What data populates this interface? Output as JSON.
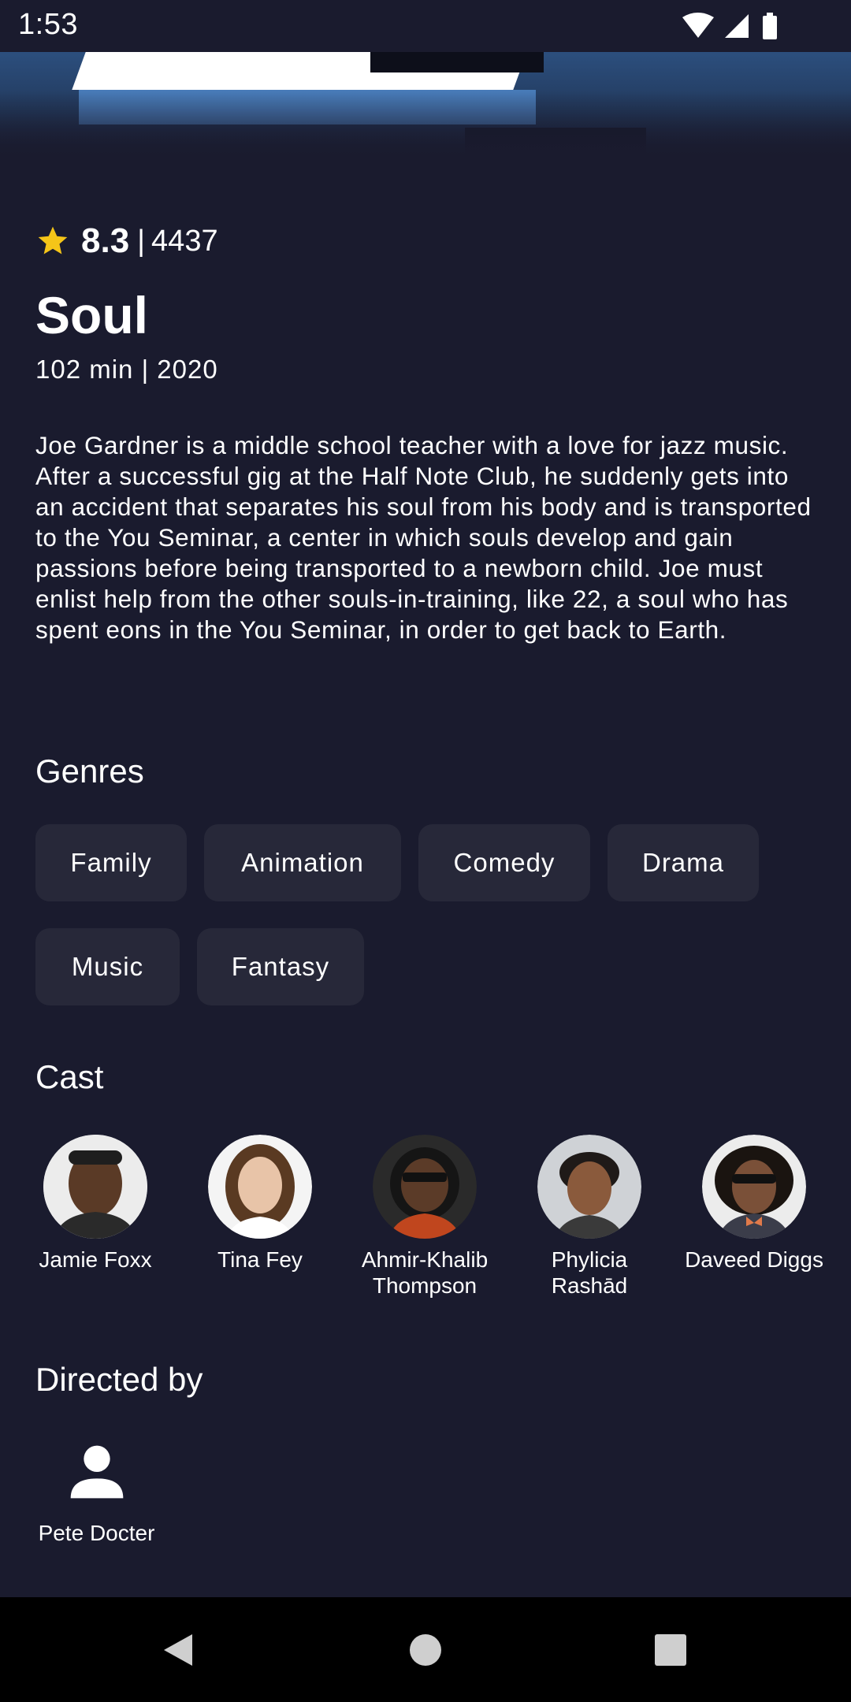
{
  "status_bar": {
    "time": "1:53"
  },
  "movie": {
    "rating": "8.3",
    "separator": "|",
    "vote_count": "4437",
    "title": "Soul",
    "meta": "102 min | 2020",
    "overview": "Joe Gardner is a middle school teacher with a love for jazz music. After a successful gig at the Half Note Club, he suddenly gets into an accident that separates his soul from his body and is transported to the You Seminar, a center in which souls develop and gain passions before being transported to a newborn child. Joe must enlist help from the other souls-in-training, like 22, a soul who has spent eons in the You Seminar, in order to get back to Earth."
  },
  "genres": {
    "title": "Genres",
    "items": [
      "Family",
      "Animation",
      "Comedy",
      "Drama",
      "Music",
      "Fantasy"
    ]
  },
  "cast": {
    "title": "Cast",
    "members": [
      {
        "name": "Jamie Foxx"
      },
      {
        "name": "Tina Fey"
      },
      {
        "name": "Ahmir-Khalib Thompson"
      },
      {
        "name": "Phylicia Rashād"
      },
      {
        "name": "Daveed Diggs"
      }
    ]
  },
  "directors": {
    "title": "Directed by",
    "items": [
      {
        "name": "Pete Docter",
        "icon": "person-icon"
      }
    ]
  },
  "colors": {
    "background": "#1a1b2e",
    "chip_background": "#272839",
    "star": "#f5c518",
    "nav_bar": "#000000"
  },
  "icons": {
    "wifi": "wifi-icon",
    "signal": "signal-icon",
    "battery": "battery-icon",
    "star": "star-icon",
    "back": "back-icon",
    "home": "home-icon",
    "recent": "recent-apps-icon"
  }
}
